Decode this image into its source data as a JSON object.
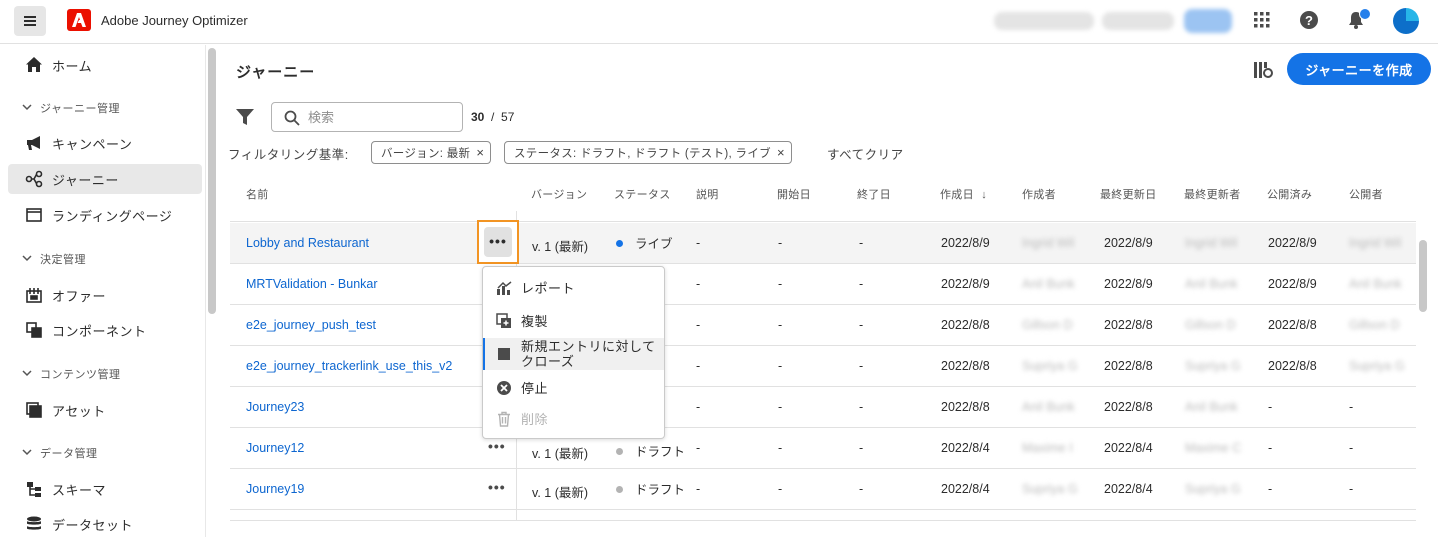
{
  "app": {
    "title": "Adobe Journey Optimizer"
  },
  "sidebar": {
    "items": [
      {
        "label": "ホーム",
        "icon": "home-icon"
      },
      {
        "label": "キャンペーン",
        "icon": "megaphone-icon"
      },
      {
        "label": "ジャーニー",
        "icon": "journey-icon",
        "active": true
      },
      {
        "label": "ランディングページ",
        "icon": "landing-page-icon"
      },
      {
        "label": "オファー",
        "icon": "offer-icon"
      },
      {
        "label": "コンポーネント",
        "icon": "component-icon"
      },
      {
        "label": "アセット",
        "icon": "asset-icon"
      },
      {
        "label": "スキーマ",
        "icon": "schema-icon"
      },
      {
        "label": "データセット",
        "icon": "dataset-icon"
      }
    ],
    "sections": [
      "ジャーニー管理",
      "決定管理",
      "コンテンツ管理",
      "データ管理"
    ]
  },
  "page": {
    "title": "ジャーニー",
    "create_button": "ジャーニーを作成",
    "search_placeholder": "検索",
    "count_shown": "30",
    "count_sep": "/",
    "count_total": "57",
    "filter_label": "フィルタリング基準:",
    "chips": [
      "バージョン: 最新",
      "ステータス: ドラフト, ドラフト (テスト), ライブ"
    ],
    "clear_all": "すべてクリア"
  },
  "table": {
    "columns": [
      "名前",
      "バージョン",
      "ステータス",
      "説明",
      "開始日",
      "終了日",
      "作成日",
      "作成者",
      "最終更新日",
      "最終更新者",
      "公開済み",
      "公開者"
    ],
    "rows": [
      {
        "name": "Lobby and Restaurant",
        "version": "v. 1 (最新)",
        "status": "ライブ",
        "status_color": "#1473e6",
        "desc": "-",
        "start": "-",
        "end": "-",
        "created": "2022/8/9",
        "creator": "Ingrid Wil",
        "updated": "2022/8/9",
        "updater": "Ingrid Wil",
        "published": "2022/8/9",
        "publisher": "Ingrid Wil"
      },
      {
        "name": "MRTValidation - Bunkar",
        "version": "",
        "status": "",
        "status_color": "",
        "desc": "-",
        "start": "-",
        "end": "-",
        "created": "2022/8/9",
        "creator": "Anil Bunk",
        "updated": "2022/8/9",
        "updater": "Anil Bunk",
        "published": "2022/8/9",
        "publisher": "Anil Bunk"
      },
      {
        "name": "e2e_journey_push_test",
        "version": "",
        "status": "",
        "status_color": "",
        "desc": "-",
        "start": "-",
        "end": "-",
        "created": "2022/8/8",
        "creator": "Gillson D",
        "updated": "2022/8/8",
        "updater": "Gillson D",
        "published": "2022/8/8",
        "publisher": "Gillson D"
      },
      {
        "name": "e2e_journey_trackerlink_use_this_v2",
        "version": "",
        "status": "",
        "status_color": "",
        "desc": "-",
        "start": "-",
        "end": "-",
        "created": "2022/8/8",
        "creator": "Supriya G",
        "updated": "2022/8/8",
        "updater": "Supriya G",
        "published": "2022/8/8",
        "publisher": "Supriya G"
      },
      {
        "name": "Journey23",
        "version": "",
        "status": "",
        "status_color": "",
        "desc": "-",
        "start": "-",
        "end": "-",
        "created": "2022/8/8",
        "creator": "Anil Bunk",
        "updated": "2022/8/8",
        "updater": "Anil Bunk",
        "published": "-",
        "publisher": "-"
      },
      {
        "name": "Journey12",
        "version": "v. 1 (最新)",
        "status": "ドラフト",
        "status_color": "#b3b3b3",
        "desc": "-",
        "start": "-",
        "end": "-",
        "created": "2022/8/4",
        "creator": "Maxime I",
        "updated": "2022/8/4",
        "updater": "Maxime C",
        "published": "-",
        "publisher": "-"
      },
      {
        "name": "Journey19",
        "version": "v. 1 (最新)",
        "status": "ドラフト",
        "status_color": "#b3b3b3",
        "desc": "-",
        "start": "-",
        "end": "-",
        "created": "2022/8/4",
        "creator": "Supriya G",
        "updated": "2022/8/4",
        "updater": "Supriya G",
        "published": "-",
        "publisher": "-"
      }
    ]
  },
  "menu": {
    "items": [
      {
        "label": "レポート",
        "icon": "report-icon"
      },
      {
        "label": "複製",
        "icon": "duplicate-icon"
      },
      {
        "label": "新規エントリに対して",
        "label2": "クローズ",
        "icon": "close-entry-icon"
      },
      {
        "label": "停止",
        "icon": "stop-icon"
      },
      {
        "label": "削除",
        "icon": "delete-icon",
        "disabled": true
      }
    ]
  },
  "colors": {
    "accent": "#1473e6",
    "link": "#0d66d0",
    "highlight": "#f29423"
  }
}
